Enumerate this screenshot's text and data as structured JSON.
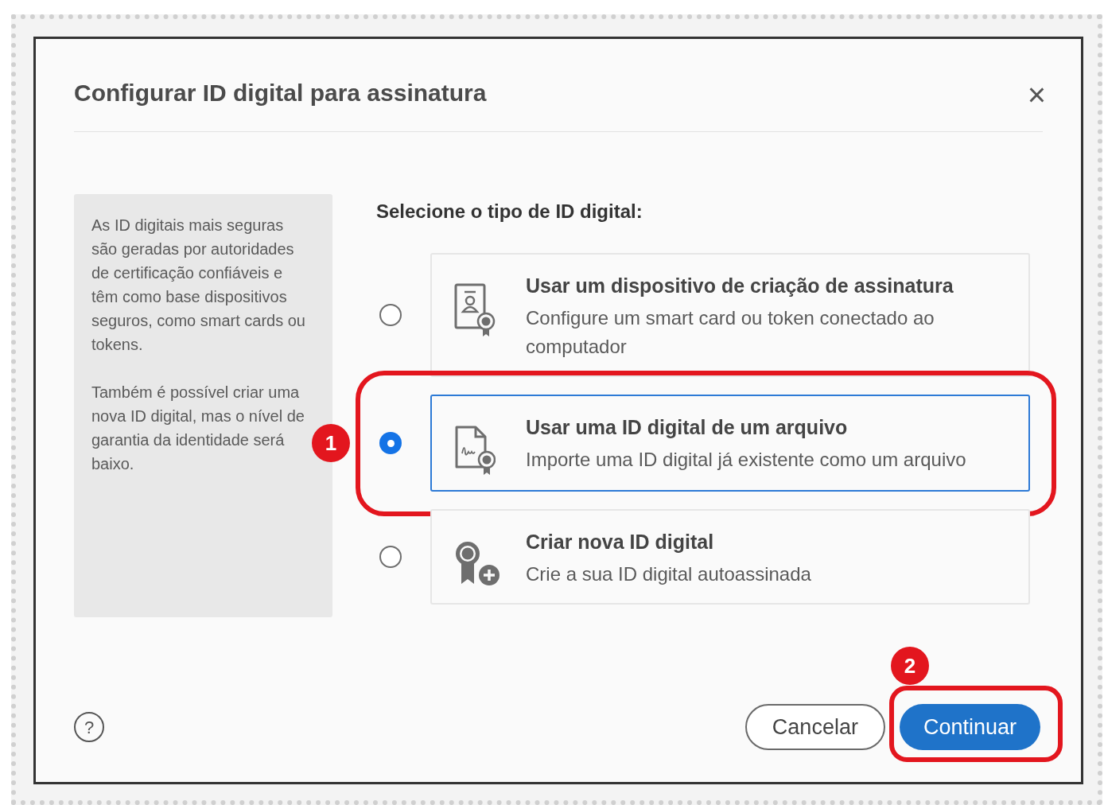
{
  "dialog": {
    "title": "Configurar ID digital para assinatura",
    "close": "×"
  },
  "info": [
    "As ID digitais mais seguras são geradas por autoridades de certificação confiáveis e têm como base dispositivos seguros, como smart cards ou tokens.",
    "Também é possível criar uma nova ID digital, mas o nível de garantia da identidade será baixo."
  ],
  "prompt": "Selecione o tipo de ID digital:",
  "options": [
    {
      "kind": "device",
      "title": "Usar um dispositivo de criação de assinatura",
      "description": "Configure um smart card ou token conectado ao computador",
      "selected": false
    },
    {
      "kind": "file",
      "title": "Usar uma ID digital de um arquivo",
      "description": "Importe uma ID digital já existente como um arquivo",
      "selected": true
    },
    {
      "kind": "new",
      "title": "Criar nova ID digital",
      "description": "Crie a sua ID digital autoassinada",
      "selected": false
    }
  ],
  "help": "?",
  "buttons": [
    {
      "kind": "secondary",
      "label": "Cancelar"
    },
    {
      "kind": "primary",
      "label": "Continuar"
    }
  ],
  "annotations": [
    {
      "kind": "options",
      "number": "1"
    },
    {
      "kind": "button",
      "number": "2"
    }
  ]
}
